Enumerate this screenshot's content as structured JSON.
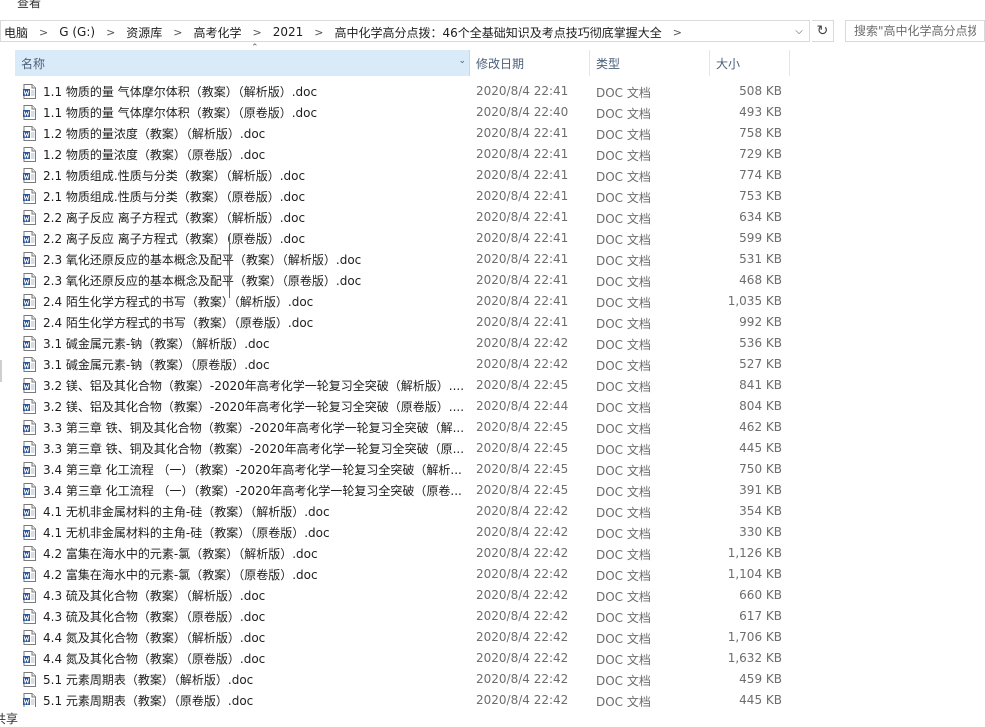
{
  "ribbon": {
    "tab": "查看"
  },
  "address": {
    "crumbs": [
      "电脑",
      "G (G:)",
      "资源库",
      "高考化学",
      "2021",
      "高中化学高分点拨：46个全基础知识及考点技巧彻底掌握大全"
    ],
    "dropdown_icon": "chevron-down-icon",
    "refresh_icon": "refresh-icon"
  },
  "search": {
    "placeholder": "搜索\"高中化学高分点拨"
  },
  "columns": {
    "name": "名称",
    "date": "修改日期",
    "type": "类型",
    "size": "大小"
  },
  "files": [
    {
      "name": "1.1 物质的量 气体摩尔体积（教案）（解析版）.doc",
      "date": "2020/8/4 22:41",
      "type": "DOC 文档",
      "size": "508 KB"
    },
    {
      "name": "1.1 物质的量 气体摩尔体积（教案）（原卷版）.doc",
      "date": "2020/8/4 22:40",
      "type": "DOC 文档",
      "size": "493 KB"
    },
    {
      "name": "1.2 物质的量浓度（教案）（解析版）.doc",
      "date": "2020/8/4 22:41",
      "type": "DOC 文档",
      "size": "758 KB"
    },
    {
      "name": "1.2 物质的量浓度（教案）（原卷版）.doc",
      "date": "2020/8/4 22:41",
      "type": "DOC 文档",
      "size": "729 KB"
    },
    {
      "name": "2.1 物质组成.性质与分类（教案）（解析版）.doc",
      "date": "2020/8/4 22:41",
      "type": "DOC 文档",
      "size": "774 KB"
    },
    {
      "name": "2.1 物质组成.性质与分类（教案）（原卷版）.doc",
      "date": "2020/8/4 22:41",
      "type": "DOC 文档",
      "size": "753 KB"
    },
    {
      "name": "2.2 离子反应 离子方程式（教案）（解析版）.doc",
      "date": "2020/8/4 22:41",
      "type": "DOC 文档",
      "size": "634 KB"
    },
    {
      "name": "2.2 离子反应 离子方程式（教案）（原卷版）.doc",
      "date": "2020/8/4 22:41",
      "type": "DOC 文档",
      "size": "599 KB"
    },
    {
      "name": "2.3 氧化还原反应的基本概念及配平（教案）（解析版）.doc",
      "date": "2020/8/4 22:41",
      "type": "DOC 文档",
      "size": "531 KB"
    },
    {
      "name": "2.3 氧化还原反应的基本概念及配平（教案）（原卷版）.doc",
      "date": "2020/8/4 22:41",
      "type": "DOC 文档",
      "size": "468 KB"
    },
    {
      "name": "2.4 陌生化学方程式的书写（教案）（解析版）.doc",
      "date": "2020/8/4 22:41",
      "type": "DOC 文档",
      "size": "1,035 KB"
    },
    {
      "name": "2.4 陌生化学方程式的书写（教案）（原卷版）.doc",
      "date": "2020/8/4 22:41",
      "type": "DOC 文档",
      "size": "992 KB"
    },
    {
      "name": "3.1 碱金属元素-钠（教案）（解析版）.doc",
      "date": "2020/8/4 22:42",
      "type": "DOC 文档",
      "size": "536 KB"
    },
    {
      "name": "3.1 碱金属元素-钠（教案）（原卷版）.doc",
      "date": "2020/8/4 22:42",
      "type": "DOC 文档",
      "size": "527 KB"
    },
    {
      "name": "3.2 镁、铝及其化合物（教案）-2020年高考化学一轮复习全突破（解析版）....",
      "date": "2020/8/4 22:45",
      "type": "DOC 文档",
      "size": "841 KB"
    },
    {
      "name": "3.2 镁、铝及其化合物（教案）-2020年高考化学一轮复习全突破（原卷版）....",
      "date": "2020/8/4 22:44",
      "type": "DOC 文档",
      "size": "804 KB"
    },
    {
      "name": "3.3 第三章 铁、铜及其化合物（教案）-2020年高考化学一轮复习全突破（解...",
      "date": "2020/8/4 22:45",
      "type": "DOC 文档",
      "size": "462 KB"
    },
    {
      "name": "3.3 第三章 铁、铜及其化合物（教案）-2020年高考化学一轮复习全突破（原...",
      "date": "2020/8/4 22:45",
      "type": "DOC 文档",
      "size": "445 KB"
    },
    {
      "name": "3.4 第三章 化工流程 （一）（教案）-2020年高考化学一轮复习全突破（解析...",
      "date": "2020/8/4 22:45",
      "type": "DOC 文档",
      "size": "750 KB"
    },
    {
      "name": "3.4 第三章 化工流程 （一）（教案）-2020年高考化学一轮复习全突破（原卷...",
      "date": "2020/8/4 22:45",
      "type": "DOC 文档",
      "size": "391 KB"
    },
    {
      "name": "4.1  无机非金属材料的主角-硅（教案）（解析版）.doc",
      "date": "2020/8/4 22:42",
      "type": "DOC 文档",
      "size": "354 KB"
    },
    {
      "name": "4.1  无机非金属材料的主角-硅（教案）（原卷版）.doc",
      "date": "2020/8/4 22:42",
      "type": "DOC 文档",
      "size": "330 KB"
    },
    {
      "name": "4.2 富集在海水中的元素-氯（教案）（解析版）.doc",
      "date": "2020/8/4 22:42",
      "type": "DOC 文档",
      "size": "1,126 KB"
    },
    {
      "name": "4.2 富集在海水中的元素-氯（教案）（原卷版）.doc",
      "date": "2020/8/4 22:42",
      "type": "DOC 文档",
      "size": "1,104 KB"
    },
    {
      "name": "4.3 硫及其化合物（教案）（解析版）.doc",
      "date": "2020/8/4 22:42",
      "type": "DOC 文档",
      "size": "660 KB"
    },
    {
      "name": "4.3 硫及其化合物（教案）（原卷版）.doc",
      "date": "2020/8/4 22:42",
      "type": "DOC 文档",
      "size": "617 KB"
    },
    {
      "name": "4.4 氮及其化合物（教案）（解析版）.doc",
      "date": "2020/8/4 22:42",
      "type": "DOC 文档",
      "size": "1,706 KB"
    },
    {
      "name": "4.4 氮及其化合物（教案）（原卷版）.doc",
      "date": "2020/8/4 22:42",
      "type": "DOC 文档",
      "size": "1,632 KB"
    },
    {
      "name": "5.1 元素周期表（教案）（解析版）.doc",
      "date": "2020/8/4 22:42",
      "type": "DOC 文档",
      "size": "459 KB"
    },
    {
      "name": "5.1 元素周期表（教案）（原卷版）.doc",
      "date": "2020/8/4 22:42",
      "type": "DOC 文档",
      "size": "445 KB"
    }
  ],
  "file_icon": "word-document-icon",
  "status": {
    "text": "共享"
  },
  "colors": {
    "header_selected": "#d9ebf9",
    "header_text": "#4c607a",
    "word_blue": "#2b579a"
  }
}
